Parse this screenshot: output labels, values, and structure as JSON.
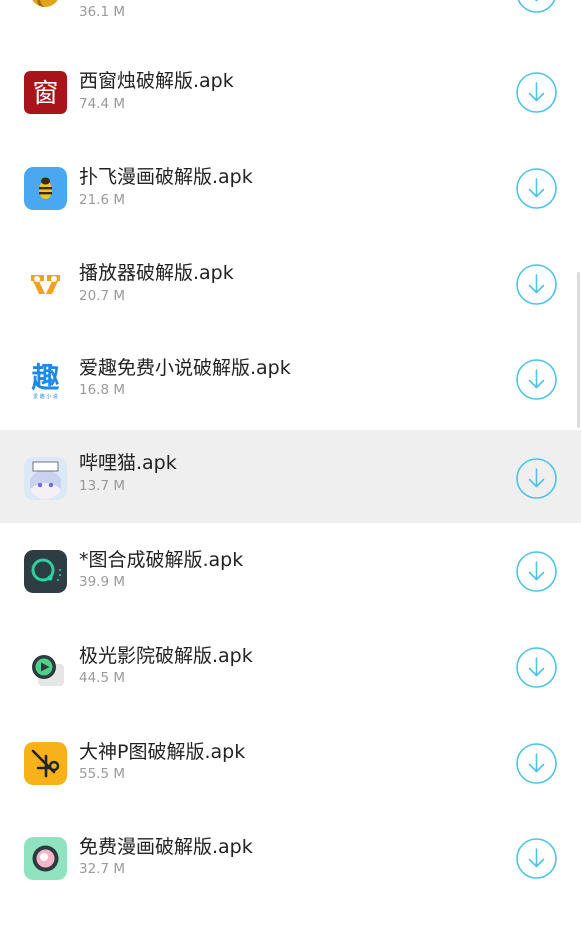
{
  "colors": {
    "accent": "#4fc3e8",
    "selected_row": "#efefef",
    "name_text": "#222222",
    "size_text": "#9a9a9a"
  },
  "apps": [
    {
      "name": "",
      "size": "36.1 M",
      "icon": "coin-icon",
      "download_icon": "download-icon"
    },
    {
      "name": "西窗烛破解版.apk",
      "size": "74.4 M",
      "icon": "window-candle-icon",
      "icon_text": "窗",
      "download_icon": "download-icon"
    },
    {
      "name": "扑飞漫画破解版.apk",
      "size": "21.6 M",
      "icon": "bee-icon",
      "download_icon": "download-icon"
    },
    {
      "name": "播放器破解版.apk",
      "size": "20.7 M",
      "icon": "player-icon",
      "download_icon": "download-icon"
    },
    {
      "name": "爱趣免费小说破解版.apk",
      "size": "16.8 M",
      "icon": "aiqu-novel-icon",
      "icon_text": "趣",
      "icon_subtext": "爱 趣 小 说",
      "download_icon": "download-icon"
    },
    {
      "name": "哔哩猫.apk",
      "size": "13.7 M",
      "icon": "anime-girl-icon",
      "download_icon": "download-icon",
      "selected": true
    },
    {
      "name": "*图合成破解版.apk",
      "size": "39.9 M",
      "icon": "ring-icon",
      "download_icon": "download-icon"
    },
    {
      "name": "极光影院破解版.apk",
      "size": "44.5 M",
      "icon": "play-circle-icon",
      "download_icon": "download-icon"
    },
    {
      "name": "大神P图破解版.apk",
      "size": "55.5 M",
      "icon": "scissors-icon",
      "download_icon": "download-icon"
    },
    {
      "name": "免费漫画破解版.apk",
      "size": "32.7 M",
      "icon": "pink-circle-icon",
      "download_icon": "download-icon"
    }
  ]
}
